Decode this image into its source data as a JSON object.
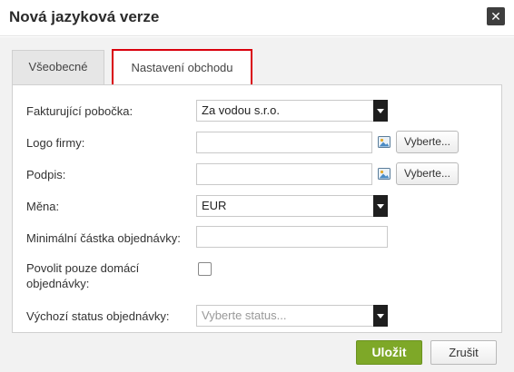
{
  "dialog": {
    "title": "Nová jazyková verze",
    "close_label": "✕"
  },
  "tabs": [
    {
      "label": "Všeobecné",
      "active": false
    },
    {
      "label": "Nastavení obchodu",
      "active": true
    }
  ],
  "form": {
    "billing_branch": {
      "label": "Fakturující pobočka:",
      "value": "Za vodou s.r.o."
    },
    "company_logo": {
      "label": "Logo firmy:",
      "value": "",
      "browse_label": "Vyberte..."
    },
    "signature": {
      "label": "Podpis:",
      "value": "",
      "browse_label": "Vyberte..."
    },
    "currency": {
      "label": "Měna:",
      "value": "EUR"
    },
    "min_order_amount": {
      "label": "Minimální částka objednávky:",
      "value": ""
    },
    "domestic_only": {
      "label_line1": "Povolit pouze domácí",
      "label_line2": "objednávky:",
      "checked": false
    },
    "default_status": {
      "label": "Výchozí status objednávky:",
      "placeholder": "Vyberte status..."
    }
  },
  "footer": {
    "save_label": "Uložit",
    "cancel_label": "Zrušit"
  },
  "colors": {
    "active_tab_border": "#d9000d",
    "save_button": "#7ea828",
    "close_button": "#3e3e3e"
  },
  "icons": {
    "close": "close-icon",
    "image_picker": "image-picker-icon",
    "dropdown": "chevron-down-icon"
  }
}
